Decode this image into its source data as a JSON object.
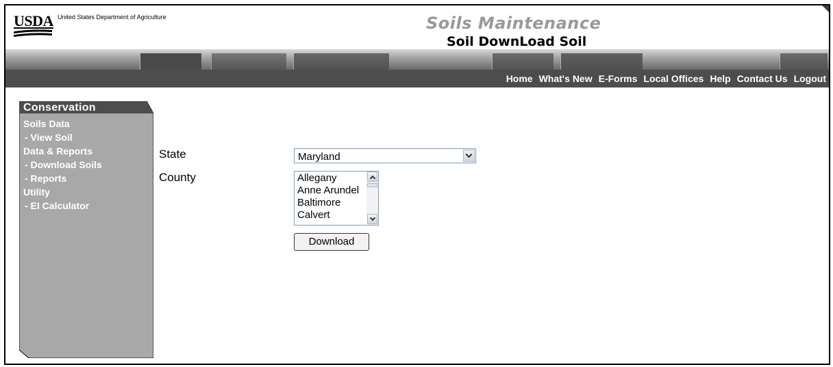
{
  "header": {
    "logo_text": "USDA",
    "agency_name": "United States Department of Agriculture",
    "app_title": "Soils Maintenance",
    "page_subtitle": "Soil DownLoad Soil"
  },
  "nav": {
    "links": [
      "Home",
      "What's New",
      "E-Forms",
      "Local Offices",
      "Help",
      "Contact Us",
      "Logout"
    ]
  },
  "sidebar": {
    "title": "Conservation",
    "groups": [
      {
        "label": "Soils Data",
        "items": [
          "- View Soil"
        ]
      },
      {
        "label": "Data & Reports",
        "items": [
          "- Download Soils",
          "- Reports"
        ]
      },
      {
        "label": "Utility",
        "items": [
          "- EI Calculator"
        ]
      }
    ]
  },
  "form": {
    "state_label": "State",
    "state_value": "Maryland",
    "county_label": "County",
    "county_options": [
      "Allegany",
      "Anne Arundel",
      "Baltimore",
      "Calvert"
    ],
    "download_label": "Download"
  },
  "colors": {
    "navbar_bg": "#4d4d4d",
    "sidebar_bg": "#a8a8a8",
    "sidebar_title_bg": "#4d4d4d",
    "app_title": "#999999"
  },
  "icons": [
    "usda-logo-icon",
    "chevron-down-icon",
    "scroll-up-icon",
    "scroll-down-icon"
  ]
}
